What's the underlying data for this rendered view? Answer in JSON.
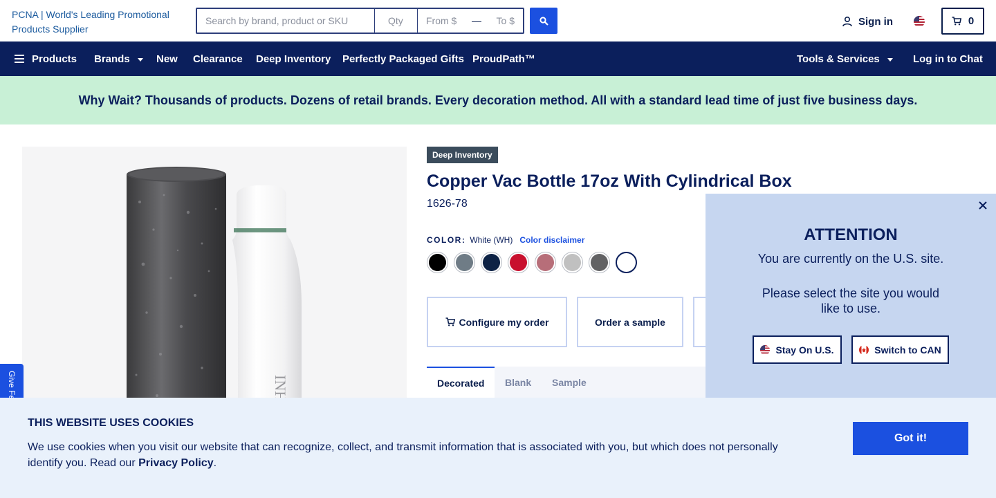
{
  "header": {
    "logo_alt": "PCNA | World's Leading Promotional Products Supplier",
    "search_placeholder": "Search by brand, product or SKU",
    "qty_placeholder": "Qty",
    "price_from_placeholder": "From $",
    "price_to_placeholder": "To $",
    "signin_label": "Sign in",
    "cart_count": "0"
  },
  "nav": {
    "items": [
      "Products",
      "Brands",
      "New",
      "Clearance",
      "Deep Inventory",
      "Perfectly Packaged Gifts",
      "ProudPath™"
    ],
    "tools_label": "Tools & Services",
    "chat_label": "Log in to Chat"
  },
  "banner": {
    "text": "Why Wait? Thousands of products. Dozens of retail brands. Every decoration method. All with a standard lead time of just five business days."
  },
  "product": {
    "badge": "Deep Inventory",
    "title": "Copper Vac Bottle 17oz With Cylindrical Box",
    "sku": "1626-78",
    "color_label": "COLOR:",
    "color_value": "White (WH)",
    "color_disclaimer": "Color disclaimer",
    "swatches": [
      {
        "color": "#000000",
        "selected": false
      },
      {
        "color": "#6f7c86",
        "selected": false
      },
      {
        "color": "#0d2245",
        "selected": false
      },
      {
        "color": "#c8102e",
        "selected": false
      },
      {
        "color": "#b76e79",
        "selected": false
      },
      {
        "color": "#c0c0c0",
        "selected": false
      },
      {
        "color": "#626264",
        "selected": false
      },
      {
        "color": "#ffffff",
        "selected": true
      }
    ],
    "configure_label": "Configure my order",
    "sample_label": "Order a sample",
    "tabs": [
      "Decorated",
      "Blank",
      "Sample"
    ],
    "bottle_imprint": "INHA EXHA"
  },
  "feedback": {
    "label": "Give Feedback"
  },
  "attention_modal": {
    "title": "ATTENTION",
    "text1": "You are currently on the U.S. site.",
    "text2": "Please select the site you would like to use.",
    "stay_label": "Stay On U.S.",
    "switch_label": "Switch to CAN"
  },
  "cookie": {
    "title": "THIS WEBSITE USES COOKIES",
    "text": "We use cookies when you visit our website that can recognize, collect, and transmit information that is associated with you, but which does not personally identify you. Read our",
    "link": "Privacy Policy",
    "period": ".",
    "button": "Got it!"
  },
  "colors": {
    "navy": "#0b1f5c",
    "accent_blue": "#1b50e0",
    "banner_green": "#c8f0d6",
    "modal_bg": "#c6d6f0",
    "cookie_bg": "#e9f1fb"
  }
}
